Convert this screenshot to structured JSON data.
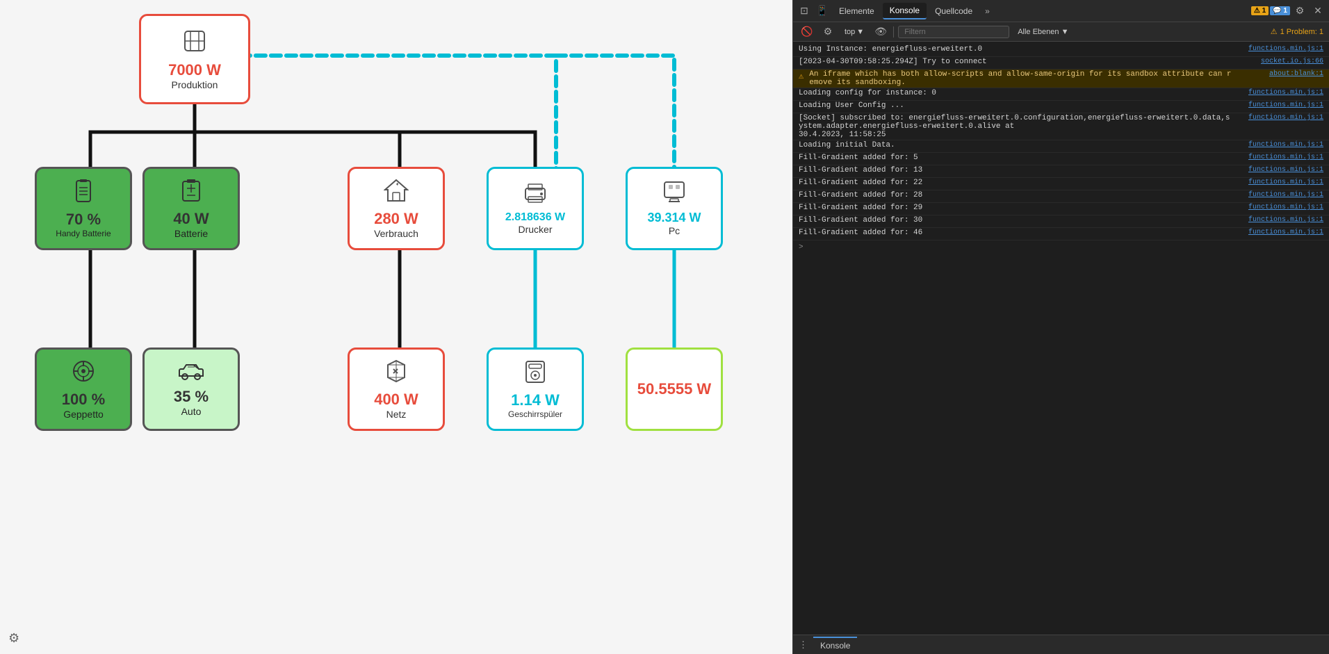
{
  "main": {
    "nodes": {
      "produktion": {
        "label": "Produktion",
        "value": "7000 W",
        "value_color": "red",
        "icon": "⊞",
        "style": "produktion"
      },
      "handy_batterie": {
        "label": "Handy Batterie",
        "value": "70 %",
        "value_color": "dark",
        "icon": "📱",
        "style": "handy-batterie"
      },
      "batterie": {
        "label": "Batterie",
        "value": "40 W",
        "value_color": "dark",
        "icon": "🔋",
        "style": "batterie"
      },
      "verbrauch": {
        "label": "Verbrauch",
        "value": "280 W",
        "value_color": "red",
        "icon": "🏠",
        "style": "verbrauch"
      },
      "drucker": {
        "label": "Drucker",
        "value": "2.818636 W",
        "value_color": "cyan",
        "icon": "🖨",
        "style": "drucker"
      },
      "pc": {
        "label": "Pc",
        "value": "39.314 W",
        "value_color": "cyan",
        "icon": "🖥",
        "style": "pc"
      },
      "geppetto": {
        "label": "Geppetto",
        "value": "100 %",
        "value_color": "dark",
        "icon": "🔄",
        "style": "geppetto"
      },
      "auto": {
        "label": "Auto",
        "value": "35 %",
        "value_color": "dark",
        "icon": "🚗",
        "style": "auto"
      },
      "netz": {
        "label": "Netz",
        "value": "400 W",
        "value_color": "red",
        "icon": "🔀",
        "style": "netz"
      },
      "geschirrspuler": {
        "label": "Geschirrspüler",
        "value": "1.14 W",
        "value_color": "cyan",
        "icon": "🍽",
        "style": "geschirrspuler"
      },
      "unknown": {
        "label": "",
        "value": "50.5555 W",
        "value_color": "red",
        "icon": "",
        "style": "unknown"
      }
    }
  },
  "devtools": {
    "tabs": [
      {
        "label": "Elemente",
        "active": false
      },
      {
        "label": "Konsole",
        "active": true
      },
      {
        "label": "Quellcode",
        "active": false
      }
    ],
    "more_tabs_label": "»",
    "toolbar": {
      "top_label": "top",
      "filter_placeholder": "Filtern",
      "levels_label": "Alle Ebenen ▼",
      "problems_label": "1 Problem: 1"
    },
    "console_lines": [
      {
        "text": "Using Instance: energiefluss-erweitert.0",
        "source": "functions.min.js:1",
        "type": "normal"
      },
      {
        "text": "[2023-04-30T09:58:25.294Z] Try to connect",
        "source": "socket.io.js:66",
        "type": "normal"
      },
      {
        "text": "⚠ An iframe which has both allow-scripts and allow-same-origin for its sandbox attribute can remove its sandboxing.",
        "source": "about:blank:1",
        "type": "warning"
      },
      {
        "text": "Loading config for instance: 0",
        "source": "functions.min.js:1",
        "type": "normal"
      },
      {
        "text": "Loading User Config ...",
        "source": "functions.min.js:1",
        "type": "normal"
      },
      {
        "text": "[Socket] subscribed to: energiefluss-erweitert.0.configuration,energiefluss-erweitert.0.data,system.adapter.energiefluss-erweitert.0.alive at\n30.4.2023, 11:58:25",
        "source": "functions.min.js:1",
        "type": "normal"
      },
      {
        "text": "Loading initial Data.",
        "source": "functions.min.js:1",
        "type": "normal"
      },
      {
        "text": "Fill-Gradient added for: 5",
        "source": "functions.min.js:1",
        "type": "normal"
      },
      {
        "text": "Fill-Gradient added for: 13",
        "source": "functions.min.js:1",
        "type": "normal"
      },
      {
        "text": "Fill-Gradient added for: 22",
        "source": "functions.min.js:1",
        "type": "normal"
      },
      {
        "text": "Fill-Gradient added for: 28",
        "source": "functions.min.js:1",
        "type": "normal"
      },
      {
        "text": "Fill-Gradient added for: 29",
        "source": "functions.min.js:1",
        "type": "normal"
      },
      {
        "text": "Fill-Gradient added for: 30",
        "source": "functions.min.js:1",
        "type": "normal"
      },
      {
        "text": "Fill-Gradient added for: 46",
        "source": "functions.min.js:1",
        "type": "normal"
      }
    ],
    "prompt": ">",
    "bottom_tab": "Konsole",
    "icons": {
      "ban": "🚫",
      "warning_count": "1",
      "message_count": "1"
    }
  }
}
